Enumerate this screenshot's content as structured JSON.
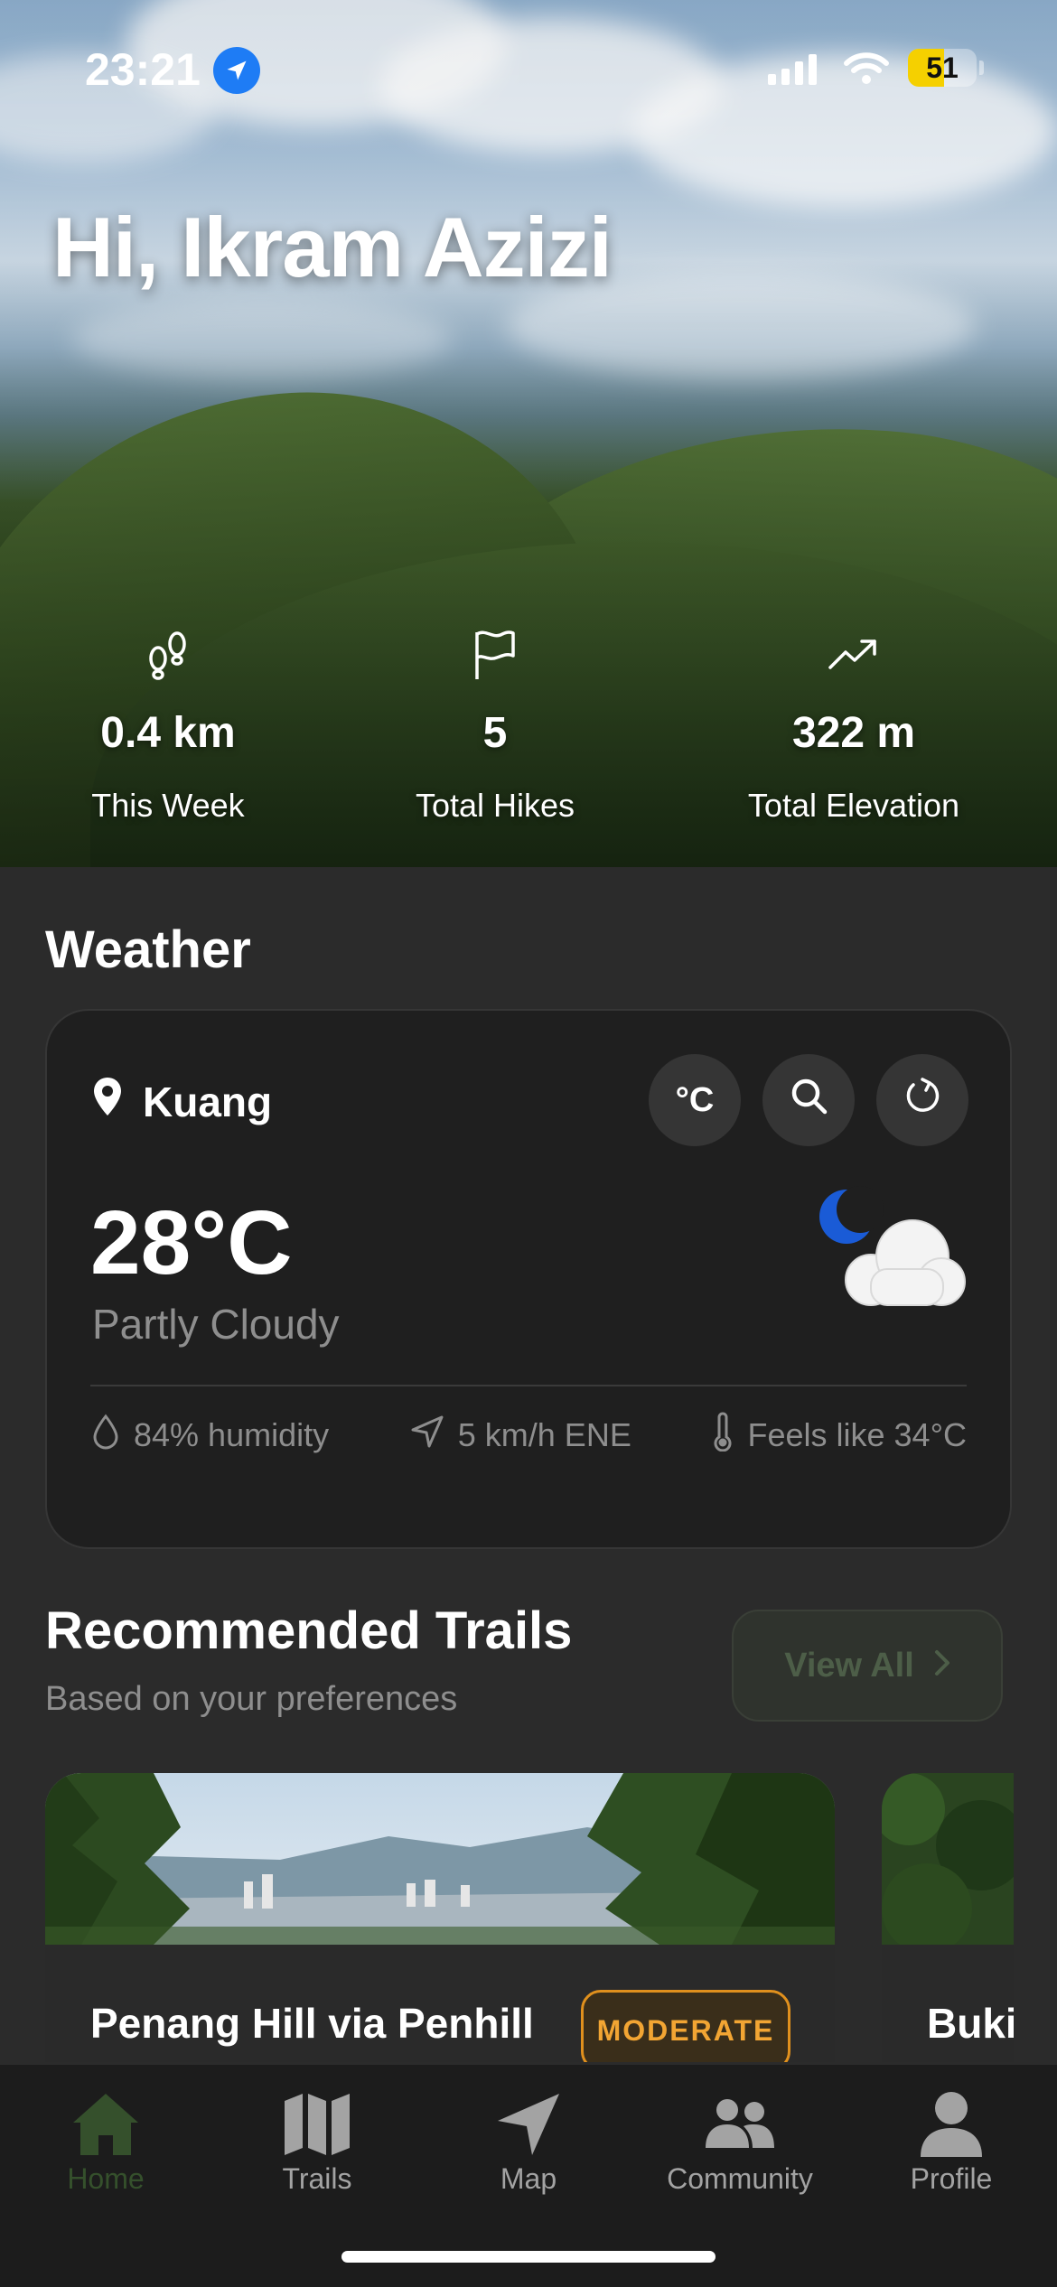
{
  "status_bar": {
    "time": "23:21",
    "battery": "51"
  },
  "header": {
    "greeting": "Hi, Ikram Azizi"
  },
  "stats": [
    {
      "icon": "footsteps-icon",
      "value": "0.4 km",
      "label": "This Week"
    },
    {
      "icon": "flag-icon",
      "value": "5",
      "label": "Total Hikes"
    },
    {
      "icon": "trending-up-icon",
      "value": "322 m",
      "label": "Total Elevation"
    }
  ],
  "weather": {
    "section_title": "Weather",
    "location": "Kuang",
    "unit_button": "°C",
    "temperature": "28°C",
    "condition": "Partly Cloudy",
    "humidity": "84% humidity",
    "wind": "5 km/h ENE",
    "feels_like": "Feels like 34°C",
    "icon": "partly-cloudy-night-icon"
  },
  "trails": {
    "title": "Recommended Trails",
    "subtitle": "Based on your preferences",
    "view_all": "View All",
    "items": [
      {
        "name": "Penang Hill via Penhill",
        "difficulty": "MODERATE"
      },
      {
        "name": "Buki"
      }
    ]
  },
  "tab_bar": {
    "active": "Home",
    "tabs": [
      {
        "label": "Home",
        "icon": "home-icon"
      },
      {
        "label": "Trails",
        "icon": "map-icon"
      },
      {
        "label": "Map",
        "icon": "navigation-icon"
      },
      {
        "label": "Community",
        "icon": "people-icon"
      },
      {
        "label": "Profile",
        "icon": "person-icon"
      }
    ]
  },
  "colors": {
    "accent_green": "#35502c",
    "badge_orange": "#f2a533",
    "location_blue": "#1e7cf5",
    "battery_yellow": "#f5d000"
  }
}
